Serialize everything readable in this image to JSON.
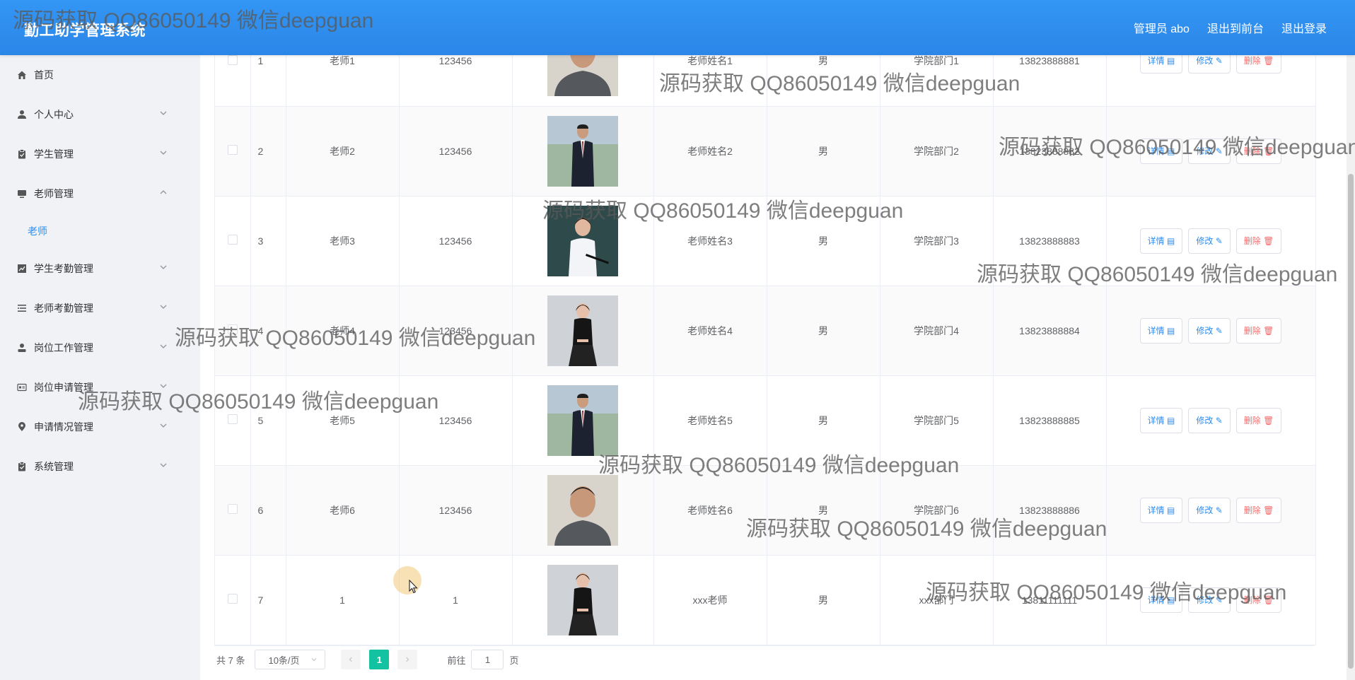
{
  "header": {
    "title": "勤工助学管理系统",
    "links": [
      "管理员 abo",
      "退出到前台",
      "退出登录"
    ]
  },
  "sidebar": {
    "items": [
      {
        "label": "首页",
        "icon": "home-icon",
        "has_arrow": false
      },
      {
        "label": "个人中心",
        "icon": "user-icon",
        "has_arrow": true
      },
      {
        "label": "学生管理",
        "icon": "clipboard-icon",
        "has_arrow": true
      },
      {
        "label": "老师管理",
        "icon": "monitor-icon",
        "has_arrow": true,
        "expanded": true,
        "children": [
          "老师"
        ]
      },
      {
        "label": "学生考勤管理",
        "icon": "chart-icon",
        "has_arrow": true
      },
      {
        "label": "老师考勤管理",
        "icon": "list-icon",
        "has_arrow": true
      },
      {
        "label": "岗位工作管理",
        "icon": "person-icon",
        "has_arrow": true
      },
      {
        "label": "岗位申请管理",
        "icon": "card-icon",
        "has_arrow": true
      },
      {
        "label": "申请情况管理",
        "icon": "location-icon",
        "has_arrow": true
      },
      {
        "label": "系统管理",
        "icon": "clipboard-icon",
        "has_arrow": true
      }
    ]
  },
  "table": {
    "rows": [
      {
        "index": "1",
        "account": "老师1",
        "password": "123456",
        "name": "老师姓名1",
        "gender": "男",
        "dept": "学院部门1",
        "phone": "13823888881",
        "photo": "male-gray"
      },
      {
        "index": "2",
        "account": "老师2",
        "password": "123456",
        "name": "老师姓名2",
        "gender": "男",
        "dept": "学院部门2",
        "phone": "13823888882",
        "photo": "male-suit"
      },
      {
        "index": "3",
        "account": "老师3",
        "password": "123456",
        "name": "老师姓名3",
        "gender": "男",
        "dept": "学院部门3",
        "phone": "13823888883",
        "photo": "female-board"
      },
      {
        "index": "4",
        "account": "老师4",
        "password": "123456",
        "name": "老师姓名4",
        "gender": "男",
        "dept": "学院部门4",
        "phone": "13823888884",
        "photo": "female-seated"
      },
      {
        "index": "5",
        "account": "老师5",
        "password": "123456",
        "name": "老师姓名5",
        "gender": "男",
        "dept": "学院部门5",
        "phone": "13823888885",
        "photo": "male-suit"
      },
      {
        "index": "6",
        "account": "老师6",
        "password": "123456",
        "name": "老师姓名6",
        "gender": "男",
        "dept": "学院部门6",
        "phone": "13823888886",
        "photo": "male-gray"
      },
      {
        "index": "7",
        "account": "1",
        "password": "1",
        "name": "xxx老师",
        "gender": "男",
        "dept": "xxx部门",
        "phone": "13811111111",
        "photo": "female-seated"
      }
    ],
    "actions": {
      "detail": "详情",
      "edit": "修改",
      "delete": "删除"
    }
  },
  "pagination": {
    "total": "共 7 条",
    "page_size": "10条/页",
    "current_page": "1",
    "goto_prefix": "前往",
    "goto_value": "1",
    "goto_suffix": "页"
  },
  "watermark": "源码获取 QQ86050149 微信deepguan",
  "colors": {
    "header": "#2d8cf0",
    "active_page": "#13c2a0",
    "delete": "#f56c6c"
  }
}
